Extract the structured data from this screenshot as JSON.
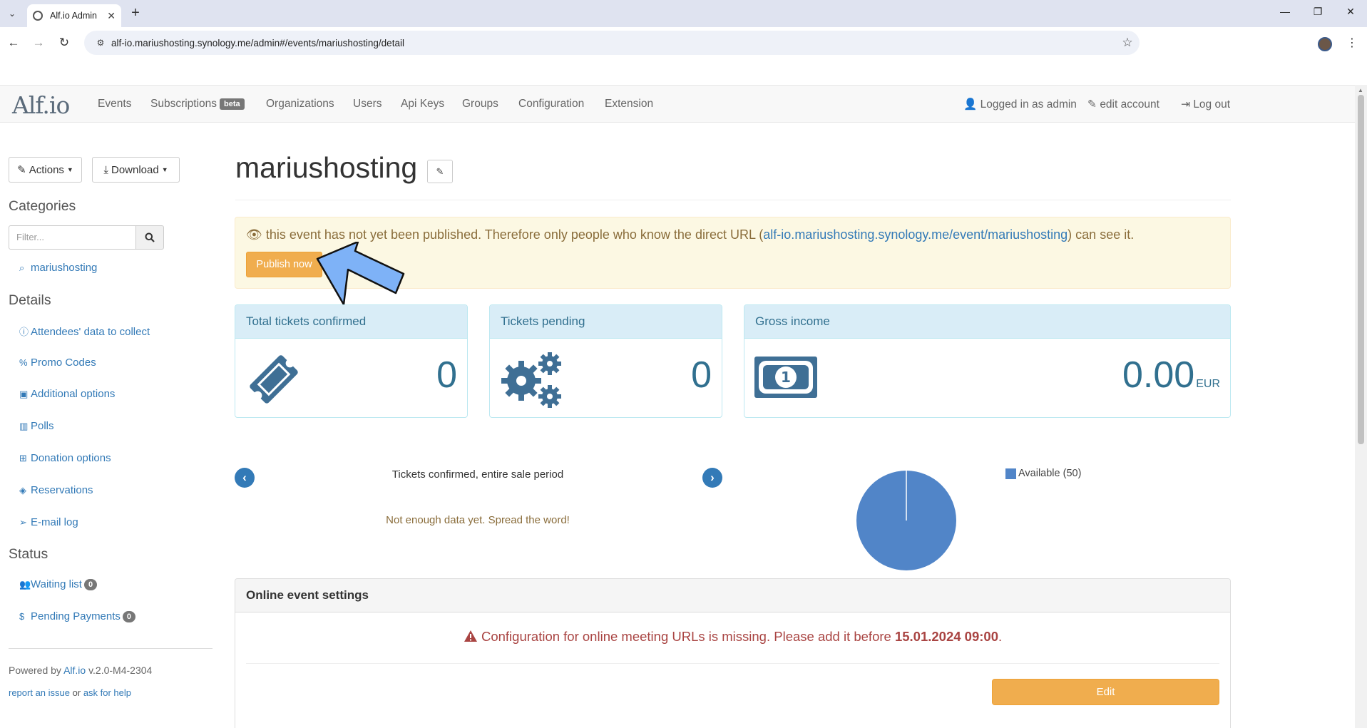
{
  "browser": {
    "tab_title": "Alf.io Admin",
    "url": "alf-io.mariushosting.synology.me/admin#/events/mariushosting/detail"
  },
  "navbar": {
    "brand": "Alf.io",
    "links": [
      "Events",
      "Subscriptions",
      "Organizations",
      "Users",
      "Api Keys",
      "Groups",
      "Configuration",
      "Extension"
    ],
    "beta_badge": "beta",
    "logged_in": "Logged in as admin",
    "edit_account": "edit account",
    "logout": "Log out"
  },
  "sidebar": {
    "actions_label": "Actions",
    "download_label": "Download",
    "categories_heading": "Categories",
    "filter_placeholder": "Filter...",
    "category_link": "mariushosting",
    "details_heading": "Details",
    "details": [
      {
        "label": "Attendees' data to collect",
        "icon": "info-circle-icon"
      },
      {
        "label": "Promo Codes",
        "icon": "percent-icon"
      },
      {
        "label": "Additional options",
        "icon": "money-icon"
      },
      {
        "label": "Polls",
        "icon": "bar-chart-icon"
      },
      {
        "label": "Donation options",
        "icon": "gift-icon"
      },
      {
        "label": "Reservations",
        "icon": "ticket-icon"
      },
      {
        "label": "E-mail log",
        "icon": "paper-plane-icon"
      }
    ],
    "status_heading": "Status",
    "waiting_list": {
      "label": "Waiting list",
      "count": "0"
    },
    "pending_payments": {
      "label": "Pending Payments",
      "count": "0"
    },
    "powered_prefix": "Powered by",
    "powered_link": "Alf.io",
    "version": "v.2.0-M4-2304",
    "report_issue": "report an issue",
    "or": "or",
    "ask_help": "ask for help"
  },
  "main": {
    "title": "mariushosting",
    "alert": {
      "text_before": "this event has not yet been published. Therefore only people who know the direct URL (",
      "link": "alf-io.mariushosting.synology.me/event/mariushosting",
      "text_after": ") can see it.",
      "publish_button": "Publish now"
    },
    "stats": [
      {
        "title": "Total tickets confirmed",
        "value": "0",
        "unit": ""
      },
      {
        "title": "Tickets pending",
        "value": "0",
        "unit": ""
      },
      {
        "title": "Gross income",
        "value": "0.00",
        "unit": "EUR"
      }
    ],
    "chart": {
      "title": "Tickets confirmed, entire sale period",
      "empty_message": "Not enough data yet. Spread the word!",
      "legend": "Available (50)",
      "color": "#5185c8"
    },
    "online_settings": {
      "heading": "Online event settings",
      "warning_prefix": "Configuration for online meeting URLs is missing. Please add it before",
      "warning_date": "15.01.2024 09:00",
      "warning_suffix": ".",
      "edit_button": "Edit"
    }
  },
  "colors": {
    "primary": "#337ab7",
    "warning": "#f0ad4e",
    "info_text": "#31708f",
    "danger_text": "#a94442"
  }
}
